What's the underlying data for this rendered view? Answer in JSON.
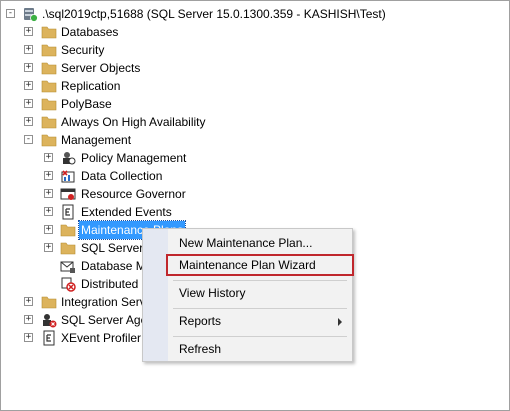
{
  "server": {
    "label": ".\\sql2019ctp,51688 (SQL Server 15.0.1300.359 - KASHISH\\Test)"
  },
  "tree": {
    "databases": "Databases",
    "security": "Security",
    "server_objects": "Server Objects",
    "replication": "Replication",
    "polybase": "PolyBase",
    "always_on": "Always On High Availability",
    "management": "Management",
    "policy_management": "Policy Management",
    "data_collection": "Data Collection",
    "resource_governor": "Resource Governor",
    "extended_events": "Extended Events",
    "maintenance_plans": "Maintenance Plans",
    "sql_server_logs": "SQL Server L",
    "database_mail": "Database M",
    "distributed": "Distributed",
    "integration_services": "Integration Servi",
    "sql_server_agent": "SQL Server Age",
    "xevent_profiler": "XEvent Profiler"
  },
  "context_menu": {
    "new_plan": "New Maintenance Plan...",
    "wizard": "Maintenance Plan Wizard",
    "view_history": "View History",
    "reports": "Reports",
    "refresh": "Refresh"
  },
  "colors": {
    "highlight_border": "#c0272d",
    "selection": "#3399ff",
    "folder": "#dcb35c"
  },
  "icons": {
    "expand_plus": "+",
    "collapse_minus": "-"
  }
}
